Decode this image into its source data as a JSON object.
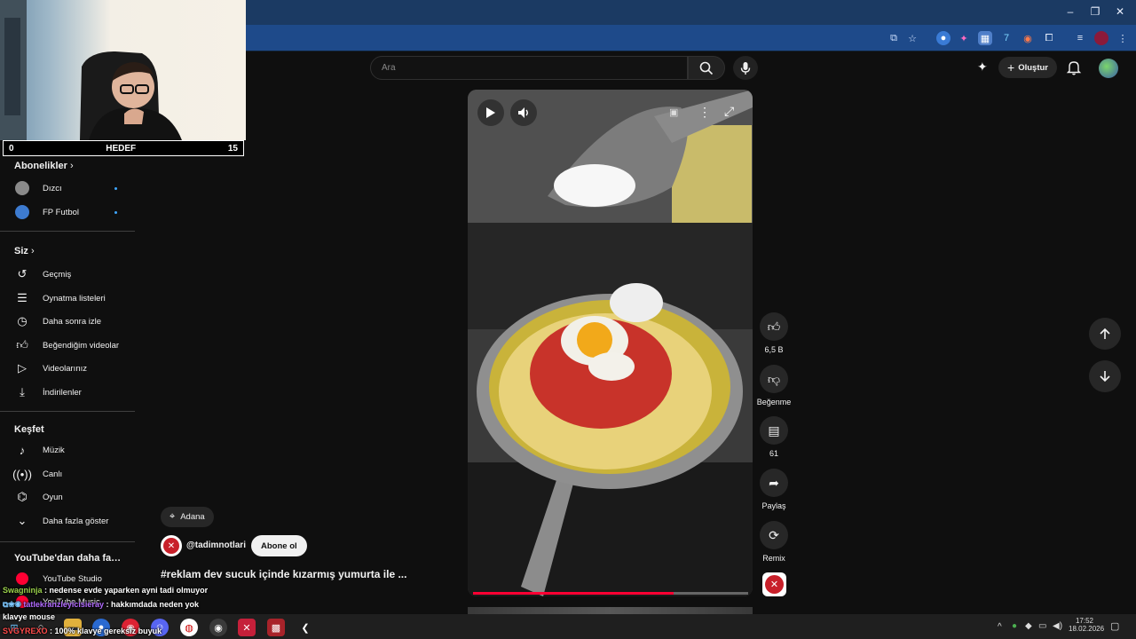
{
  "browser": {
    "window_controls": {
      "minimize": "–",
      "restore": "❐",
      "close": "✕"
    }
  },
  "stream": {
    "goal_start": "0",
    "goal_label": "HEDEF",
    "goal_end": "15"
  },
  "sidebar": {
    "subscriptions": {
      "title": "Abonelikler",
      "items": [
        {
          "label": "Dızcı",
          "icon": "channel-avatar-icon"
        },
        {
          "label": "FP Futbol",
          "icon": "channel-avatar-icon"
        }
      ]
    },
    "you": {
      "title": "Siz",
      "items": [
        {
          "label": "Geçmiş",
          "icon": "history-icon"
        },
        {
          "label": "Oynatma listeleri",
          "icon": "playlist-icon"
        },
        {
          "label": "Daha sonra izle",
          "icon": "clock-icon"
        },
        {
          "label": "Beğendiğim videolar",
          "icon": "thumbs-up-icon"
        },
        {
          "label": "Videolarınız",
          "icon": "video-icon"
        },
        {
          "label": "İndirilenler",
          "icon": "download-icon"
        }
      ]
    },
    "explore": {
      "title": "Keşfet",
      "items": [
        {
          "label": "Müzik",
          "icon": "music-icon"
        },
        {
          "label": "Canlı",
          "icon": "live-icon"
        },
        {
          "label": "Oyun",
          "icon": "gamepad-icon"
        },
        {
          "label": "Daha fazla göster",
          "icon": "chevron-down-icon"
        }
      ]
    },
    "more_from_youtube": {
      "title": "YouTube'dan daha fazlası",
      "items": [
        {
          "label": "YouTube Studio"
        },
        {
          "label": "YouTube Music"
        }
      ]
    }
  },
  "header": {
    "search_placeholder": "Ara",
    "create_label": "Oluştur"
  },
  "short": {
    "location": "Adana",
    "channel": "@tadimnotlari",
    "subscribe_label": "Abone ol",
    "title": "#reklam dev sucuk içinde kızarmış yumurta ile ...",
    "actions": {
      "likes": "6,5 B",
      "dislike": "Beğenme",
      "comments": "61",
      "share": "Paylaş",
      "remix": "Remix"
    }
  },
  "chat": [
    {
      "user": "Swagninja",
      "message": " : nedense evde yaparken ayni tadi olmuyor",
      "user_color": "#9ad14b"
    },
    {
      "user": "tatlekranzleyicisieray",
      "message": " : hakkımdada neden yok",
      "user_color": "#b26bff"
    },
    {
      "user": "",
      "message": "klavye mouse",
      "user_color": "#ffffff"
    },
    {
      "user": "SVGYREXO",
      "message": " : 100% klavye gereksiz buyuk",
      "user_color": "#ff4a4a"
    }
  ],
  "taskbar": {
    "time": "17:52",
    "date": "18.02.2026"
  },
  "colors": {
    "youtube_bg": "#0f0f0f",
    "browser_blue": "#1e4a8a",
    "accent_red": "#ff0033"
  }
}
